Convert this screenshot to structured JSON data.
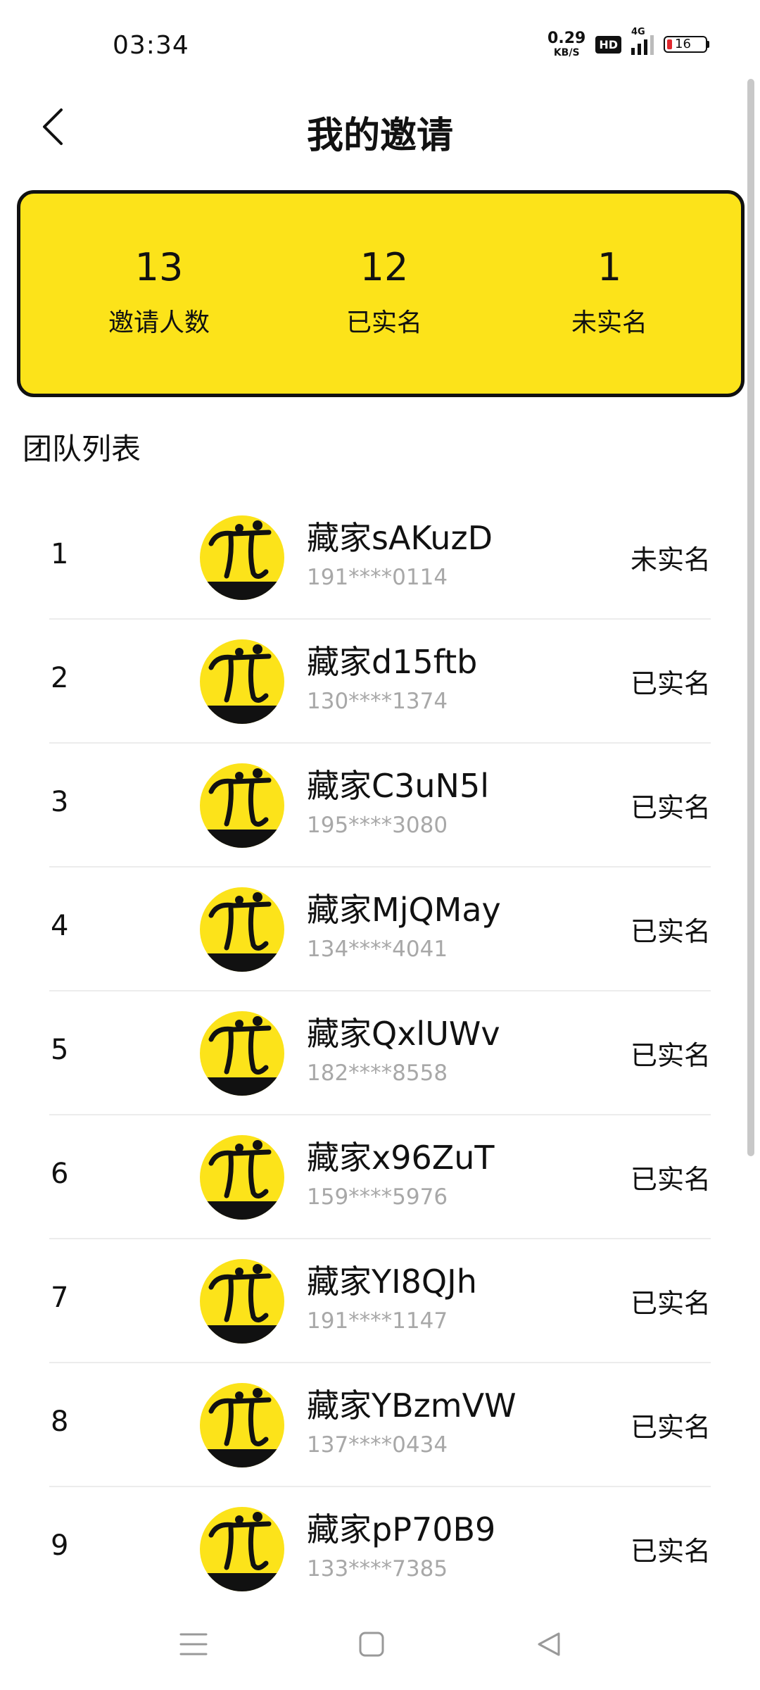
{
  "status_bar": {
    "time": "03:34",
    "net_speed_value": "0.29",
    "net_speed_unit": "KB/S",
    "hd_label": "HD",
    "network_label": "4G",
    "battery_level": "16",
    "battery_low_color": "#e0282e"
  },
  "header": {
    "title": "我的邀请",
    "back_icon": "chevron-left-icon"
  },
  "summary": {
    "accent_color": "#fce31a",
    "stats": [
      {
        "value": "13",
        "label": "邀请人数"
      },
      {
        "value": "12",
        "label": "已实名"
      },
      {
        "value": "1",
        "label": "未实名"
      }
    ]
  },
  "team_section": {
    "title": "团队列表",
    "members": [
      {
        "index": "1",
        "name": "藏家sAKuzD",
        "phone": "191****0114",
        "status": "未实名"
      },
      {
        "index": "2",
        "name": "藏家d15ftb",
        "phone": "130****1374",
        "status": "已实名"
      },
      {
        "index": "3",
        "name": "藏家C3uN5l",
        "phone": "195****3080",
        "status": "已实名"
      },
      {
        "index": "4",
        "name": "藏家MjQMay",
        "phone": "134****4041",
        "status": "已实名"
      },
      {
        "index": "5",
        "name": "藏家QxlUWv",
        "phone": "182****8558",
        "status": "已实名"
      },
      {
        "index": "6",
        "name": "藏家x96ZuT",
        "phone": "159****5976",
        "status": "已实名"
      },
      {
        "index": "7",
        "name": "藏家YI8QJh",
        "phone": "191****1147",
        "status": "已实名"
      },
      {
        "index": "8",
        "name": "藏家YBzmVW",
        "phone": "137****0434",
        "status": "已实名"
      },
      {
        "index": "9",
        "name": "藏家pP70B9",
        "phone": "133****7385",
        "status": "已实名"
      }
    ]
  },
  "nav_bar": {
    "buttons": [
      "menu-icon",
      "home-square-icon",
      "back-triangle-icon"
    ]
  }
}
